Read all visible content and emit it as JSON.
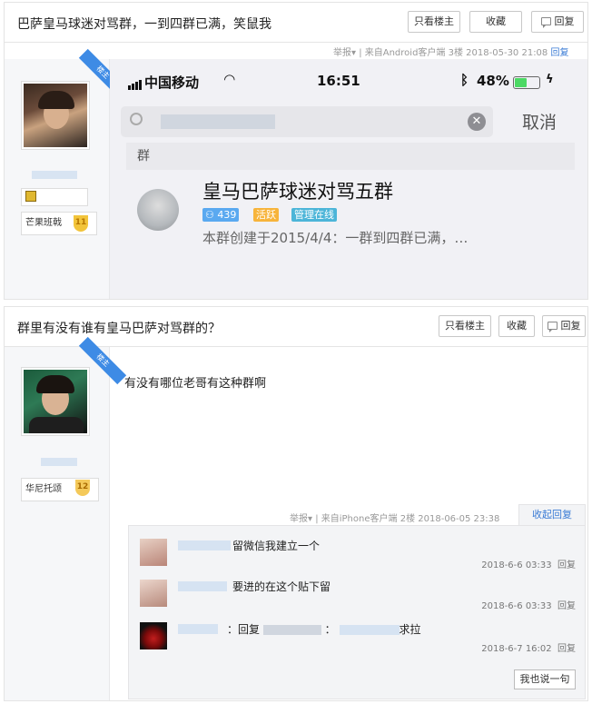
{
  "post1": {
    "title": "巴萨皇马球迷对骂群，一到四群已满，笑鼠我",
    "btn_only_host": "只看楼主",
    "btn_fav": "收藏",
    "btn_reply": "回复",
    "ribbon": "楼主",
    "level_name": "芒果班戟",
    "level_num": "11",
    "report": "举报",
    "source": "| 来自Android客户端",
    "floor": "3楼",
    "time": "2018-05-30 21:08",
    "reply_link": "回复",
    "phone": {
      "carrier": "中国移动",
      "clock": "16:51",
      "battery": "48%",
      "cancel": "取消",
      "section": "群",
      "group_name": "皇马巴萨球迷对骂五群",
      "tags": [
        "439",
        "活跃",
        "管理在线"
      ],
      "description": "本群创建于2015/4/4：一群到四群已满，…"
    }
  },
  "post2": {
    "title": "群里有没有谁有皇马巴萨对骂群的？",
    "btn_only_host": "只看楼主",
    "btn_fav": "收藏",
    "btn_reply": "回复",
    "ribbon": "楼主",
    "level_name": "华尼托颂",
    "level_num": "12",
    "body": "有没有哪位老哥有这种群啊",
    "report": "举报",
    "source": "| 来自iPhone客户端",
    "floor": "2楼",
    "time": "2018-06-05 23:38",
    "collapse": "收起回复",
    "replies": [
      {
        "text": "留微信我建立一个",
        "time": "2018-6-6 03:33",
        "action": "回复"
      },
      {
        "text": "要进的在这个贴下留",
        "time": "2018-6-6 03:33",
        "action": "回复"
      },
      {
        "prefix": "：回复",
        "sep": "：",
        "text": "求拉",
        "time": "2018-6-7 16:02",
        "action": "回复"
      }
    ],
    "say_btn": "我也说一句"
  },
  "colors": {
    "accent": "#3a7bd5",
    "ribbon": "#3e8be5",
    "badge": "#f2c43a"
  }
}
